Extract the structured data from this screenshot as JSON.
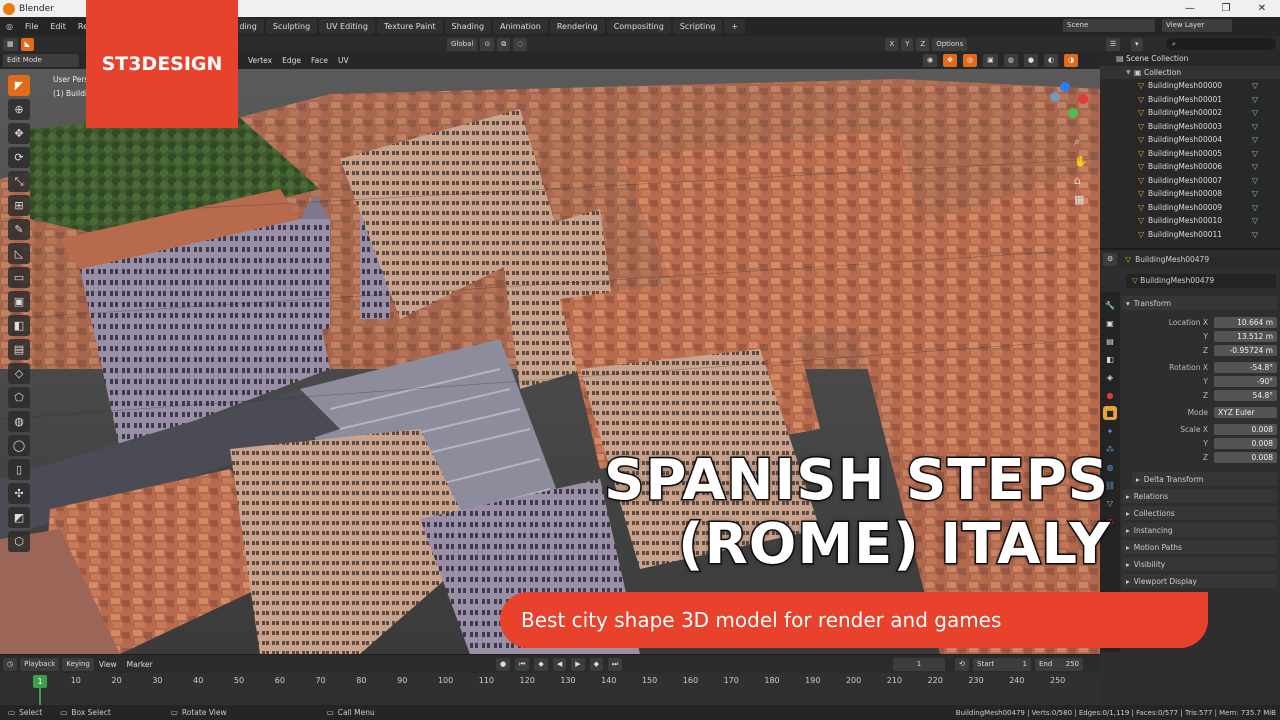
{
  "window": {
    "title": "Blender",
    "controls": [
      "—",
      "❐",
      "✕"
    ]
  },
  "menu": [
    "File",
    "Edit",
    "Render"
  ],
  "workspaces": [
    "Sculpting",
    "UV Editing",
    "Texture Paint",
    "Shading",
    "Animation",
    "Rendering",
    "Compositing",
    "Scripting"
  ],
  "workspace_partial": "ding",
  "add_tab": "+",
  "scene": {
    "label": "Scene",
    "view_layer": "View Layer"
  },
  "viewport_header": {
    "mode": "Edit Mode",
    "menus": [
      "Vertex",
      "Edge",
      "Face",
      "UV"
    ],
    "transform_orientation": "Global",
    "axes": [
      "X",
      "Y",
      "Z"
    ],
    "options": "Options",
    "view_label": "User Pers",
    "object_label": "(1) Buildi"
  },
  "outliner": {
    "root": "Scene Collection",
    "collection": "Collection",
    "items": [
      "BuildingMesh00000",
      "BuildingMesh00001",
      "BuildingMesh00002",
      "BuildingMesh00003",
      "BuildingMesh00004",
      "BuildingMesh00005",
      "BuildingMesh00006",
      "BuildingMesh00007",
      "BuildingMesh00008",
      "BuildingMesh00009",
      "BuildingMesh00010",
      "BuildingMesh00011"
    ]
  },
  "properties": {
    "object_name": "BuildingMesh00479",
    "object_name2": "BuildingMesh00479",
    "transform": "Transform",
    "location": {
      "label": "Location X",
      "x": "10.664 m",
      "y": "13.512 m",
      "z": "-0.95724 m"
    },
    "rotation": {
      "label": "Rotation X",
      "x": "-54.8°",
      "y": "-90°",
      "z": "54.8°"
    },
    "mode": {
      "label": "Mode",
      "value": "XYZ Euler"
    },
    "scale": {
      "label": "Scale X",
      "x": "0.008",
      "y": "0.008",
      "z": "0.008"
    },
    "axis_y": "Y",
    "axis_z": "Z",
    "sections": [
      "Delta Transform",
      "Relations",
      "Collections",
      "Instancing",
      "Motion Paths",
      "Visibility",
      "Viewport Display"
    ]
  },
  "timeline": {
    "menus": [
      "Playback",
      "Keying",
      "View",
      "Marker"
    ],
    "current_frame": "1",
    "start_label": "Start",
    "start": "1",
    "end_label": "End",
    "end": "250",
    "ticks": [
      "1",
      "10",
      "20",
      "30",
      "40",
      "50",
      "60",
      "70",
      "80",
      "90",
      "100",
      "110",
      "120",
      "130",
      "140",
      "150",
      "160",
      "170",
      "180",
      "190",
      "200",
      "210",
      "220",
      "230",
      "240",
      "250"
    ]
  },
  "statusbar": {
    "select": "Select",
    "box_select": "Box Select",
    "rotate_view": "Rotate View",
    "call_menu": "Call Menu",
    "stats": "BuildingMesh00479 | Verts:0/580 | Edges:0/1,119 | Faces:0/577 | Tris:577 | Mem: 735.7 MiB"
  },
  "overlay": {
    "brand": "ST3DESIGN",
    "headline_line1": "SPANISH STEPS",
    "headline_line2": "(ROME) ITALY",
    "tagline": "Best city shape 3D model for render and games"
  },
  "colors": {
    "brand": "#e6432f",
    "accent": "#e26b1a",
    "mesh_icon": "#7fd18c"
  }
}
